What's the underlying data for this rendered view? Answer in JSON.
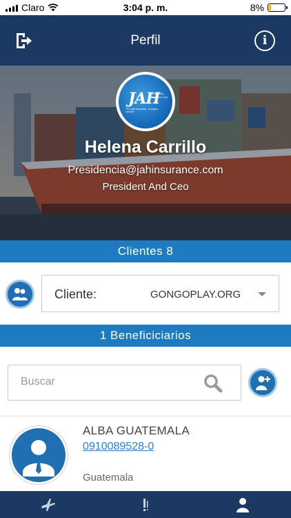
{
  "status_bar": {
    "carrier": "Claro",
    "time": "3:04 p. m.",
    "battery_percent": "8%",
    "battery_level": 0.08,
    "battery_color": "#f2b705"
  },
  "header": {
    "title": "Perfil",
    "logout_icon": "logout-icon",
    "info_icon": "info-icon",
    "background": "#1b3963"
  },
  "profile": {
    "logo_text": "JAH",
    "logo_subtext": "Insurance Brokers Corp",
    "logo_tagline": "The right insurance - la seguro correcto",
    "name": "Helena Carrillo",
    "email": "Presidencia@jahinsurance.com",
    "role": "President And Ceo"
  },
  "clients_bar": {
    "label": "Clientes 8"
  },
  "client_selector": {
    "label": "Cliente:",
    "selected": "GONGOPLAY.ORG",
    "icon": "clients-icon"
  },
  "beneficiaries_bar": {
    "label": "1 Beneficiciarios"
  },
  "search": {
    "placeholder": "Buscar",
    "value": ""
  },
  "beneficiaries": [
    {
      "name": "ALBA GUATEMALA",
      "phone": "0910089528-0",
      "country": "Guatemala"
    }
  ],
  "bottom_nav": {
    "items": [
      {
        "icon": "airplane-icon"
      },
      {
        "icon": "exclamation-icon"
      },
      {
        "icon": "user-icon",
        "active": true
      }
    ]
  },
  "colors": {
    "accent_bar": "#1f7bc1",
    "navy": "#1b3963",
    "link": "#2a7fd4"
  }
}
